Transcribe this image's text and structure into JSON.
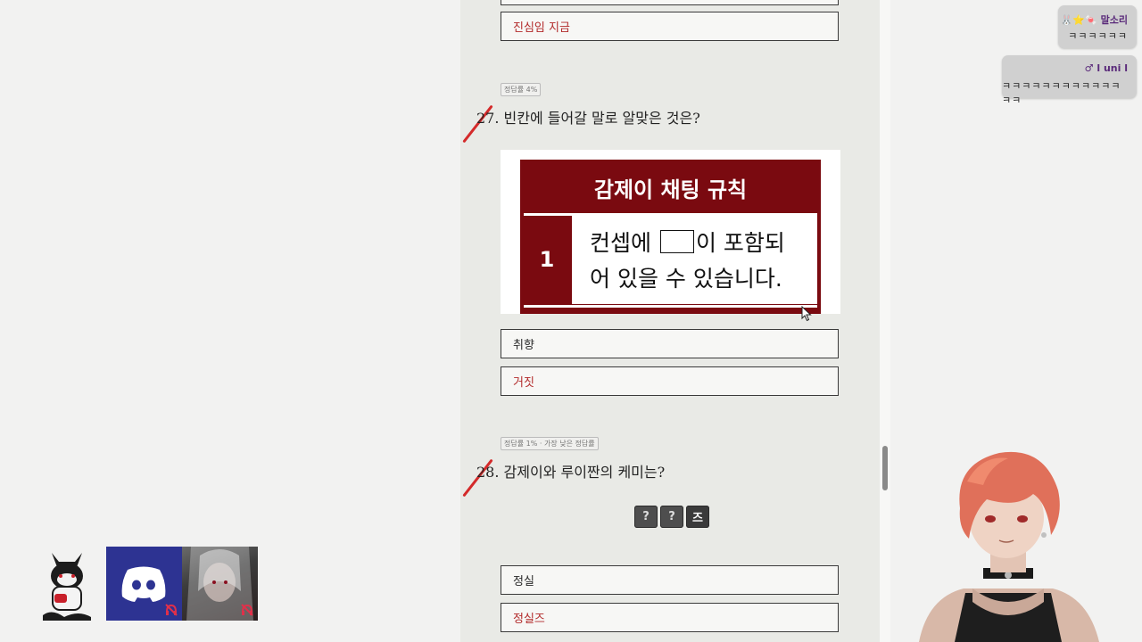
{
  "quiz": {
    "prev_choice_label": "진심임 지금",
    "q27": {
      "rate": "정답률 4%",
      "text": "27. 빈칸에 들어갈 말로 알맞은 것은?",
      "image": {
        "title": "감제이 채팅 규칙",
        "rule_number": "1",
        "rule_line1_pre": "컨셉에",
        "rule_line1_post": "이 포함되",
        "rule_line2": "어 있을 수 있습니다."
      },
      "choices": [
        {
          "label": "취향",
          "state": "normal"
        },
        {
          "label": "거짓",
          "state": "wrong"
        }
      ]
    },
    "q28": {
      "rate": "정답률 1% · 가장 낮은 정답률",
      "text": "28. 감제이와 루이짠의 케미는?",
      "hint_tiles": [
        "?",
        "?",
        "즈"
      ],
      "choices": [
        {
          "label": "정실",
          "state": "normal"
        },
        {
          "label": "정실즈",
          "state": "wrong"
        }
      ]
    }
  },
  "chat": [
    {
      "name": "🐰⭐🍬 말소리",
      "message": "ㅋㅋㅋㅋㅋㅋ"
    },
    {
      "name": "♂ l uni l",
      "message": "ㅋㅋㅋㅋㅋㅋㅋㅋㅋㅋㅋㅋㅋㅋ"
    }
  ],
  "colors": {
    "accent_red": "#b22a2a",
    "banner_red": "#7a0a10",
    "discord_blue": "#2d3392"
  },
  "icons": {
    "discord": "discord-icon",
    "mute": "muted-headset-icon",
    "cursor": "mouse-pointer-icon"
  }
}
